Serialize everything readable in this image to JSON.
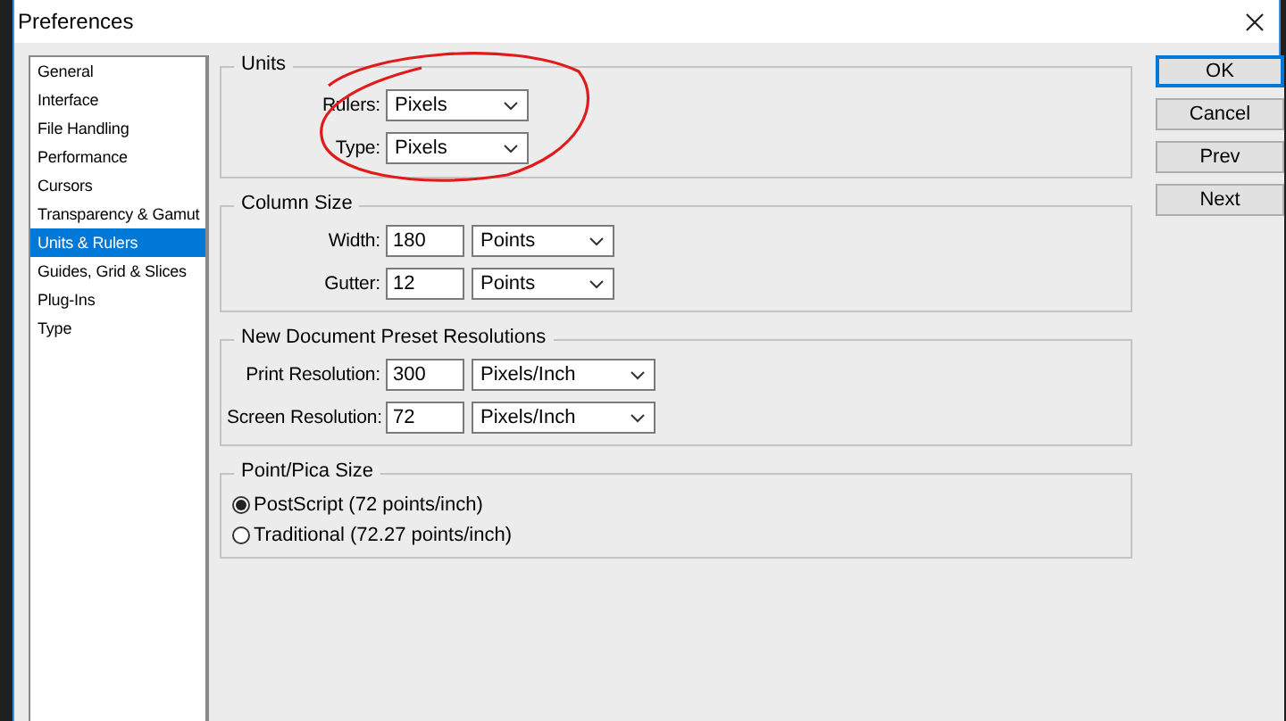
{
  "window": {
    "title": "Preferences"
  },
  "sidebar": {
    "items": [
      {
        "label": "General",
        "selected": false
      },
      {
        "label": "Interface",
        "selected": false
      },
      {
        "label": "File Handling",
        "selected": false
      },
      {
        "label": "Performance",
        "selected": false
      },
      {
        "label": "Cursors",
        "selected": false
      },
      {
        "label": "Transparency & Gamut",
        "selected": false
      },
      {
        "label": "Units & Rulers",
        "selected": true
      },
      {
        "label": "Guides, Grid & Slices",
        "selected": false
      },
      {
        "label": "Plug-Ins",
        "selected": false
      },
      {
        "label": "Type",
        "selected": false
      }
    ]
  },
  "groups": [
    {
      "kind": "fields",
      "title": "Units",
      "fields": [
        {
          "label": "Rulers:",
          "dropdown": "Pixels"
        },
        {
          "label": "Type:",
          "dropdown": "Pixels"
        }
      ]
    },
    {
      "kind": "fields",
      "title": "Column Size",
      "fields": [
        {
          "label": "Width:",
          "value": "180",
          "dropdown": "Points"
        },
        {
          "label": "Gutter:",
          "value": "12",
          "dropdown": "Points"
        }
      ]
    },
    {
      "kind": "fields",
      "title": "New Document Preset Resolutions",
      "fields": [
        {
          "label": "Print Resolution:",
          "value": "300",
          "dropdown": "Pixels/Inch"
        },
        {
          "label": "Screen Resolution:",
          "value": "72",
          "dropdown": "Pixels/Inch"
        }
      ]
    },
    {
      "kind": "radios",
      "title": "Point/Pica Size",
      "options": [
        {
          "label": "PostScript (72 points/inch)",
          "selected": true
        },
        {
          "label": "Traditional (72.27 points/inch)",
          "selected": false
        }
      ]
    }
  ],
  "buttons": [
    {
      "label": "OK",
      "default": true
    },
    {
      "label": "Cancel",
      "default": false
    },
    {
      "label": "Prev",
      "default": false
    },
    {
      "label": "Next",
      "default": false
    }
  ]
}
